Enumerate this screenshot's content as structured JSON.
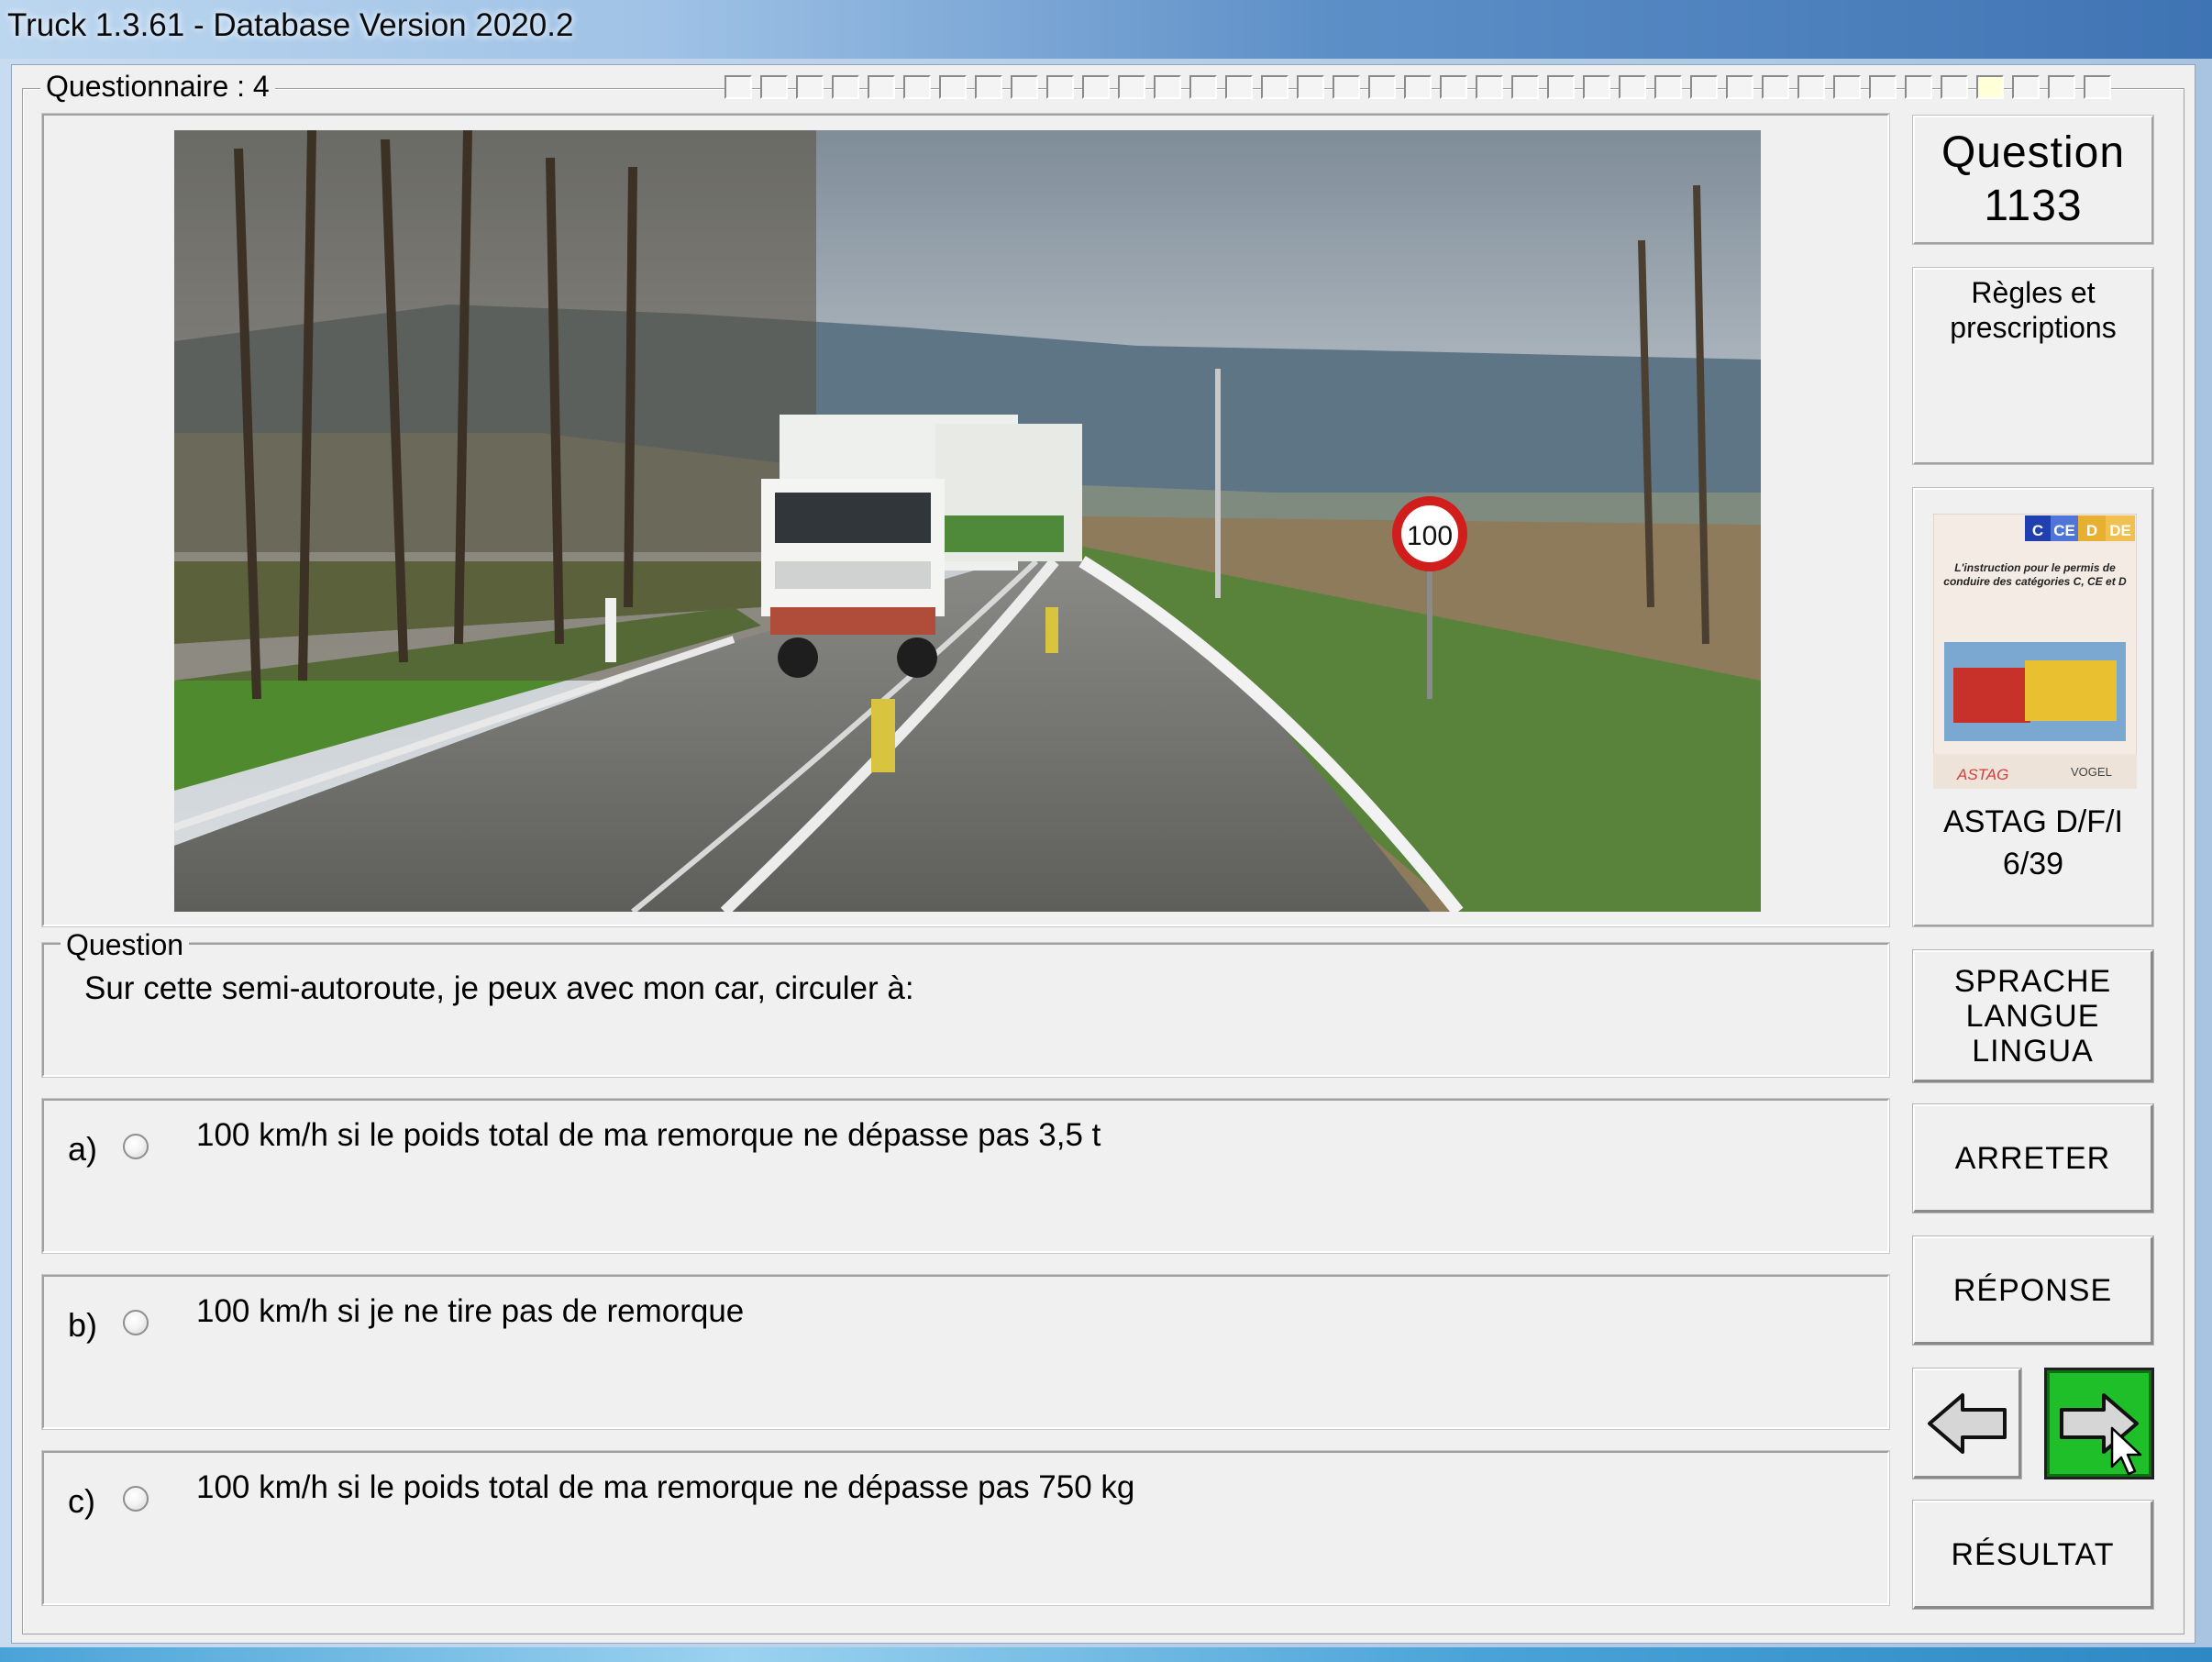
{
  "window": {
    "title": "Truck 1.3.61 - Database Version 2020.2"
  },
  "questionnaire": {
    "label": "Questionnaire : 4",
    "progress_total": 39,
    "progress_current": 36
  },
  "photo": {
    "sign_text": "100"
  },
  "question": {
    "group_label": "Question",
    "text": "Sur cette semi-autoroute, je peux avec mon car, circuler à:"
  },
  "answers": [
    {
      "letter": "a)",
      "text": "100 km/h si le poids total de ma remorque ne dépasse pas 3,5 t"
    },
    {
      "letter": "b)",
      "text": "100 km/h si je ne tire pas de remorque"
    },
    {
      "letter": "c)",
      "text": "100 km/h si le poids total de ma remorque ne dépasse pas 750 kg"
    }
  ],
  "sidebar": {
    "question_title": "Question",
    "question_number": "1133",
    "category_line1": "Règles et",
    "category_line2": "prescriptions",
    "book": {
      "badges": [
        "C",
        "CE",
        "D",
        "DE"
      ],
      "cover_text": "L'instruction pour le permis de conduire des catégories C, CE et D",
      "publisher_left": "ASTAG",
      "publisher_right": "VOGEL",
      "caption_line1": "ASTAG D/F/I",
      "caption_line2": "6/39"
    },
    "language_button": [
      "SPRACHE",
      "LANGUE",
      "LINGUA"
    ],
    "stop_button": "ARRETER",
    "answer_button": "RÉPONSE",
    "result_button": "RÉSULTAT",
    "back_icon": "arrow-left-icon",
    "next_icon": "arrow-right-icon"
  },
  "colors": {
    "next_button": "#1fbf2a",
    "panel": "#f0f0f0"
  }
}
